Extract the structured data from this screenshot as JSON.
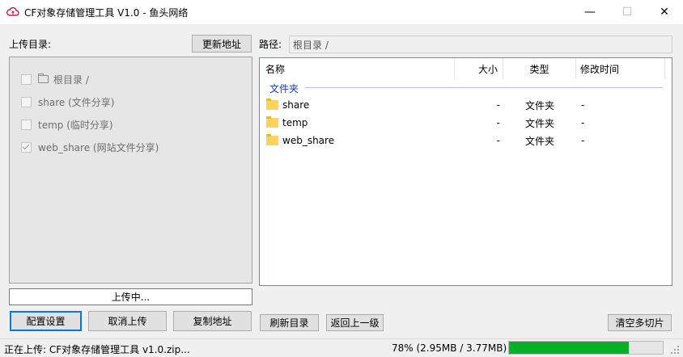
{
  "window": {
    "title": "CF对象存储管理工具 V1.0 - 鱼头网络",
    "minimize": "—",
    "maximize": "☐",
    "close": "✕"
  },
  "left": {
    "upload_dir_label": "上传目录:",
    "update_address_button": "更新地址",
    "directories": [
      {
        "label": "根目录 /",
        "checked": false,
        "has_folder_icon": true
      },
      {
        "label": "share (文件分享)",
        "checked": false,
        "has_folder_icon": false
      },
      {
        "label": "temp (临时分享)",
        "checked": false,
        "has_folder_icon": false
      },
      {
        "label": "web_share (网站文件分享)",
        "checked": true,
        "has_folder_icon": false
      }
    ],
    "upload_status": "上传中...",
    "buttons": {
      "config": "配置设置",
      "cancel_upload": "取消上传",
      "copy_address": "复制地址"
    }
  },
  "right": {
    "path_label": "路径:",
    "path_value": "根目录 /",
    "columns": {
      "name": "名称",
      "size": "大小",
      "type": "类型",
      "modified": "修改时间"
    },
    "group_label": "文件夹",
    "rows": [
      {
        "name": "share",
        "size": "-",
        "type": "文件夹",
        "modified": "-"
      },
      {
        "name": "temp",
        "size": "-",
        "type": "文件夹",
        "modified": "-"
      },
      {
        "name": "web_share",
        "size": "-",
        "type": "文件夹",
        "modified": "-"
      }
    ],
    "buttons": {
      "refresh": "刷新目录",
      "back": "返回上一级",
      "clear_chunks": "清空多切片"
    }
  },
  "statusbar": {
    "uploading_text": "正在上传: CF对象存储管理工具 v1.0.zip...",
    "progress_text": "78% (2.95MB / 3.77MB)",
    "progress_percent": 78
  },
  "colors": {
    "accent": "#0078d7",
    "progress": "#06b025",
    "folder": "#ffd35c",
    "group_label": "#1e3c9c"
  }
}
